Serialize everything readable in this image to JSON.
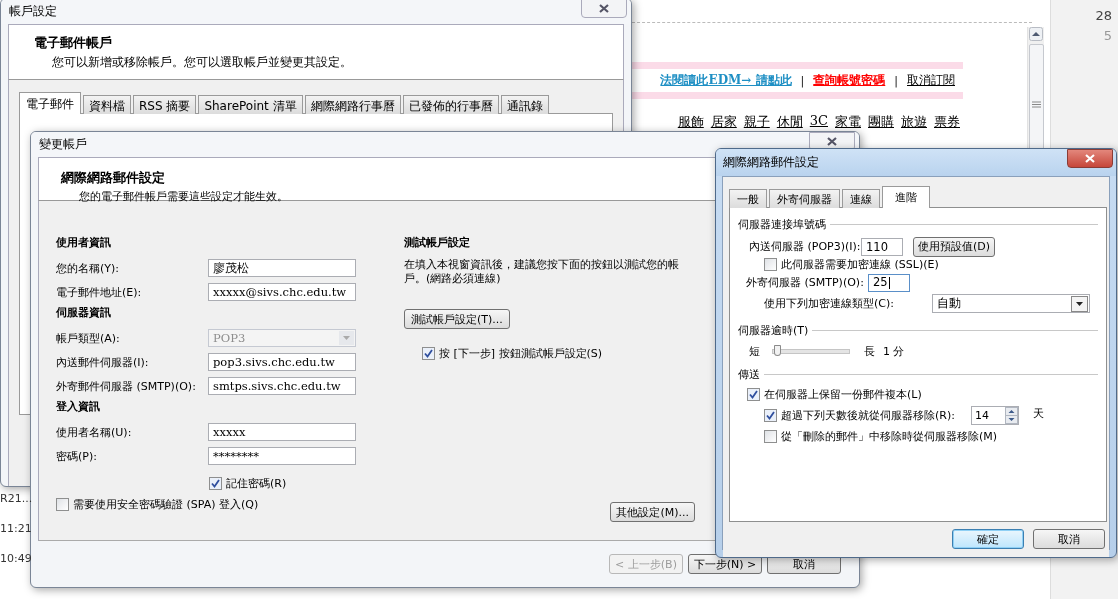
{
  "background_page": {
    "link_bar": [
      {
        "kind": "link",
        "text": "法閱讀此EDM→  請點此"
      },
      {
        "kind": "separator",
        "text": "|"
      },
      {
        "kind": "alert-link",
        "text": "查詢帳號密碼"
      },
      {
        "kind": "separator",
        "text": "|"
      },
      {
        "kind": "plain-link",
        "text": "取消訂閱"
      }
    ],
    "categories": [
      "服飾",
      "居家",
      "親子",
      "休閒",
      "3C",
      "家電",
      "團購",
      "旅遊",
      "票券"
    ],
    "calendar_days": [
      "28",
      "5"
    ],
    "message_list": [
      "R21...",
      "11:21",
      "10:49"
    ]
  },
  "account_settings": {
    "title": "帳戶設定",
    "heading": "電子郵件帳戶",
    "subtitle": "您可以新增或移除帳戶。您可以選取帳戶並變更其設定。",
    "tabs": [
      {
        "label": "電子郵件",
        "selected": true
      },
      {
        "label": "資料檔",
        "selected": false
      },
      {
        "label": "RSS 摘要",
        "selected": false
      },
      {
        "label": "SharePoint 清單",
        "selected": false
      },
      {
        "label": "網際網路行事曆",
        "selected": false
      },
      {
        "label": "已發佈的行事曆",
        "selected": false
      },
      {
        "label": "通訊錄",
        "selected": false
      }
    ]
  },
  "change_account": {
    "title": "變更帳戶",
    "heading": "網際網路郵件設定",
    "subtitle": "您的電子郵件帳戶需要這些設定才能生效。",
    "sections": [
      {
        "heading": "使用者資訊",
        "fields": [
          {
            "kind": "text",
            "label": "您的名稱(Y):",
            "value": "廖茂松"
          },
          {
            "kind": "text",
            "label": "電子郵件地址(E):",
            "value": "xxxxx@sivs.chc.edu.tw"
          }
        ]
      },
      {
        "heading": "伺服器資訊",
        "fields": [
          {
            "kind": "dropdown",
            "label": "帳戶類型(A):",
            "value": "POP3",
            "disabled": true
          },
          {
            "kind": "text",
            "label": "內送郵件伺服器(I):",
            "value": "pop3.sivs.chc.edu.tw"
          },
          {
            "kind": "text",
            "label": "外寄郵件伺服器 (SMTP)(O):",
            "value": "smtps.sivs.chc.edu.tw"
          }
        ]
      },
      {
        "heading": "登入資訊",
        "fields": [
          {
            "kind": "text",
            "label": "使用者名稱(U):",
            "value": "xxxxx"
          },
          {
            "kind": "text",
            "label": "密碼(P):",
            "value": "********"
          }
        ]
      }
    ],
    "remember_password": {
      "label": "記住密碼(R)",
      "checked": true
    },
    "spa": {
      "label": "需要使用安全密碼驗證 (SPA) 登入(Q)",
      "checked": false
    },
    "test": {
      "heading": "測試帳戶設定",
      "description": "在填入本視窗資訊後，建議您按下面的按鈕以測試您的帳戶。(網路必須連線)",
      "button": "測試帳戶設定(T)...",
      "checkbox": {
        "label": "按 [下一步] 按鈕測試帳戶設定(S)",
        "checked": true
      }
    },
    "more_settings": "其他設定(M)...",
    "buttons": [
      {
        "label": "< 上一步(B)",
        "disabled": true
      },
      {
        "label": "下一步(N) >",
        "disabled": false
      },
      {
        "label": "取消",
        "disabled": false
      }
    ]
  },
  "mail_settings": {
    "title": "網際網路郵件設定",
    "tabs": [
      {
        "label": "一般",
        "selected": false
      },
      {
        "label": "外寄伺服器",
        "selected": false
      },
      {
        "label": "連線",
        "selected": false
      },
      {
        "label": "進階",
        "selected": true
      }
    ],
    "ports": {
      "title": "伺服器連接埠號碼",
      "incoming_label": "內送伺服器 (POP3)(I):",
      "incoming_value": "110",
      "default_button": "使用預設值(D)",
      "ssl": {
        "label": "此伺服器需要加密連線 (SSL)(E)",
        "checked": false
      },
      "outgoing_label": "外寄伺服器 (SMTP)(O):",
      "outgoing_value": "25",
      "encryption_label": "使用下列加密連線類型(C):",
      "encryption_value": "自動"
    },
    "timeout": {
      "title": "伺服器逾時(T)",
      "short": "短",
      "long": "長",
      "reading": "1 分",
      "level": 0.05
    },
    "delivery": {
      "title": "傳送",
      "items": [
        {
          "kind": "checkbox",
          "label": "在伺服器上保留一份郵件複本(L)",
          "checked": true,
          "children": [
            {
              "kind": "days",
              "label": "超過下列天數後就從伺服器移除(R):",
              "checked": true,
              "value": "14",
              "unit": "天"
            },
            {
              "kind": "checkbox",
              "label": "從「刪除的郵件」中移除時從伺服器移除(M)",
              "checked": false
            }
          ]
        }
      ]
    },
    "buttons": [
      {
        "label": "確定",
        "default": true
      },
      {
        "label": "取消",
        "default": false
      }
    ]
  }
}
